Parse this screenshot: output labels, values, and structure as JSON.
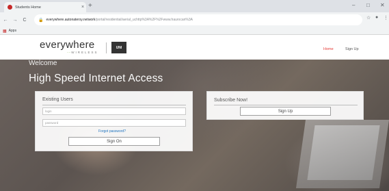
{
  "browser": {
    "tab_title": "Students Home",
    "tab_close": "×",
    "new_tab": "+",
    "window_controls": [
      "–",
      "□",
      "✕"
    ],
    "nav": {
      "back": "←",
      "forward": "→",
      "reload": "C"
    },
    "url_host": "everywhere.autonatersy.network",
    "url_path": "/portal/residential/aerial_uchttp%3A%2F%2Fwww.haurocan%3A",
    "bookmark_label": "Apps",
    "menu": "⋮"
  },
  "site": {
    "logo_text": "everywhere",
    "logo_sub": "WIRELESS",
    "partner_badge": "UNI",
    "nav_home": "Home",
    "nav_signup": "Sign Up",
    "colors": {
      "home_link": "#e53935",
      "signup_link": "#555555",
      "logo_accent": "#7cb342"
    }
  },
  "hero": {
    "welcome": "Welcome",
    "headline": "High Speed Internet Access"
  },
  "existing_users": {
    "title": "Existing Users",
    "login_placeholder": "login",
    "password_placeholder": "password",
    "forgot_label": "Forgot password?",
    "signin_label": "Sign On"
  },
  "subscribe": {
    "title": "Subscribe Now!",
    "signup_label": "Sign Up"
  }
}
